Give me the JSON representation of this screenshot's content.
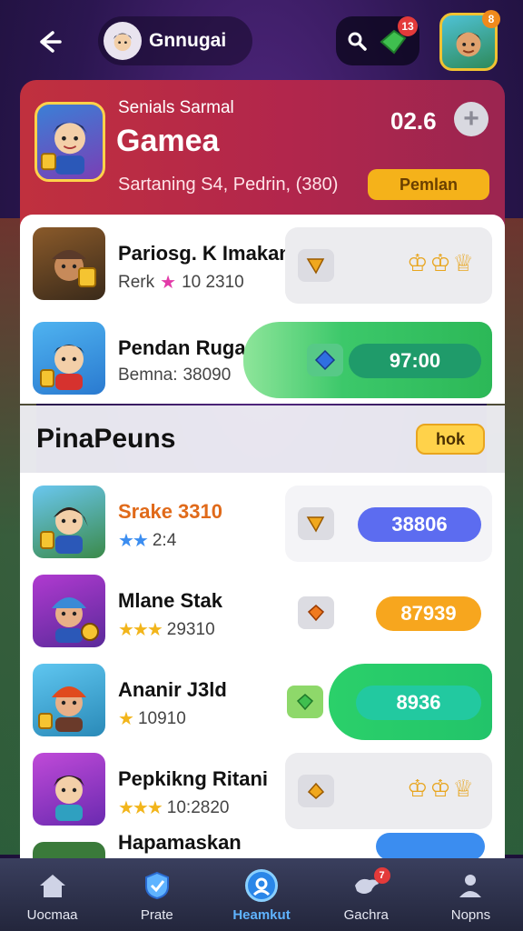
{
  "header": {
    "profile_name": "Gnnugai",
    "notification_count": "13",
    "avatar_badge": "8"
  },
  "hero": {
    "subtitle": "Senials Sarmal",
    "title": "Gamea",
    "description": "Sartaning S4, Pedrin, (380)",
    "score": "02.6",
    "plus_label": "+",
    "button_label": "Pemlan"
  },
  "top_rows": [
    {
      "title": "Pariosg. K Imakan",
      "sub_prefix": "Rerk",
      "sub_value": "10 2310",
      "side": "trophies"
    },
    {
      "title": "Pendan Rugan",
      "sub_prefix": "Bemna:",
      "sub_value": "38090",
      "side_value": "97:00"
    }
  ],
  "section": {
    "title": "PinaPeuns",
    "button_label": "hok"
  },
  "rows": [
    {
      "title": "Srake 3310",
      "stars": "★★",
      "sub_value": "2:4",
      "side_value": "38806",
      "side_color": "#5c6cf0"
    },
    {
      "title": "Mlane Stak",
      "stars": "★★★",
      "sub_value": "29310",
      "side_value": "87939",
      "side_color": "#f7a61e"
    },
    {
      "title": "Ananir J3ld",
      "stars": "★",
      "sub_value": "10910",
      "side_value": "8936",
      "side_color": "#2bc18c"
    },
    {
      "title": "Pepkikng Ritani",
      "stars": "★★★",
      "sub_value": "10:2820",
      "side": "trophies"
    },
    {
      "title": "Hapamaskan"
    }
  ],
  "nav": {
    "items": [
      {
        "label": "Uocmaa",
        "icon": "home-icon"
      },
      {
        "label": "Prate",
        "icon": "shield-icon"
      },
      {
        "label": "Heamkut",
        "icon": "profile-ring-icon"
      },
      {
        "label": "Gachra",
        "icon": "bird-icon",
        "badge": "7"
      },
      {
        "label": "Nopns",
        "icon": "person-icon"
      }
    ]
  },
  "colors": {
    "hero_red": "#c0303e",
    "gold": "#f5b21a",
    "green": "#2cb857",
    "blue_pill": "#5c6cf0",
    "orange_pill": "#f7a61e",
    "teal_pill": "#2bc18c",
    "active_nav": "#2a86e8"
  }
}
